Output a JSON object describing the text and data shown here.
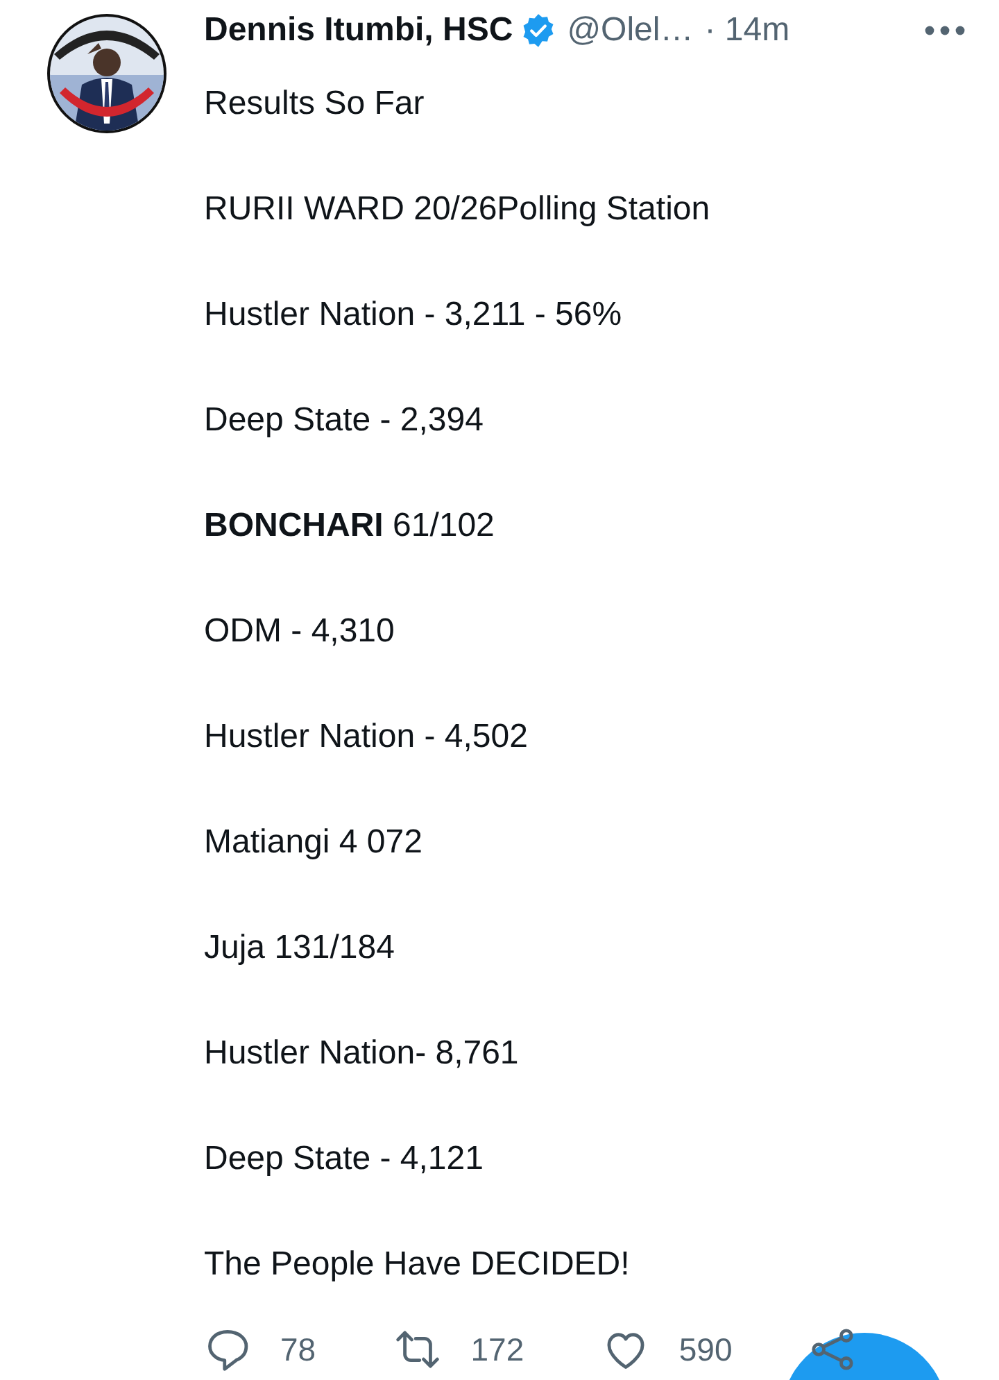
{
  "tweet": {
    "author": {
      "name": "Dennis Itumbi, HSC",
      "verified": true,
      "handle": "@Olel…",
      "time": "· 14m"
    },
    "paragraphs": [
      "Results So Far",
      "RURII WARD 20/26Polling Station",
      "Hustler Nation - 3,211 - 56%",
      "Deep State - 2,394",
      "**BONCHARI** 61/102",
      "ODM - 4,310",
      "Hustler Nation - 4,502",
      "Matiangi 4 072",
      "Juja 131/184",
      "Hustler Nation- 8,761",
      "Deep State - 4,121",
      "The People Have DECIDED!"
    ],
    "actions": [
      {
        "kind": "reply",
        "count": "78"
      },
      {
        "kind": "retweet",
        "count": "172"
      },
      {
        "kind": "like",
        "count": "590"
      },
      {
        "kind": "share"
      }
    ]
  },
  "compose_button": {
    "visible": true
  }
}
